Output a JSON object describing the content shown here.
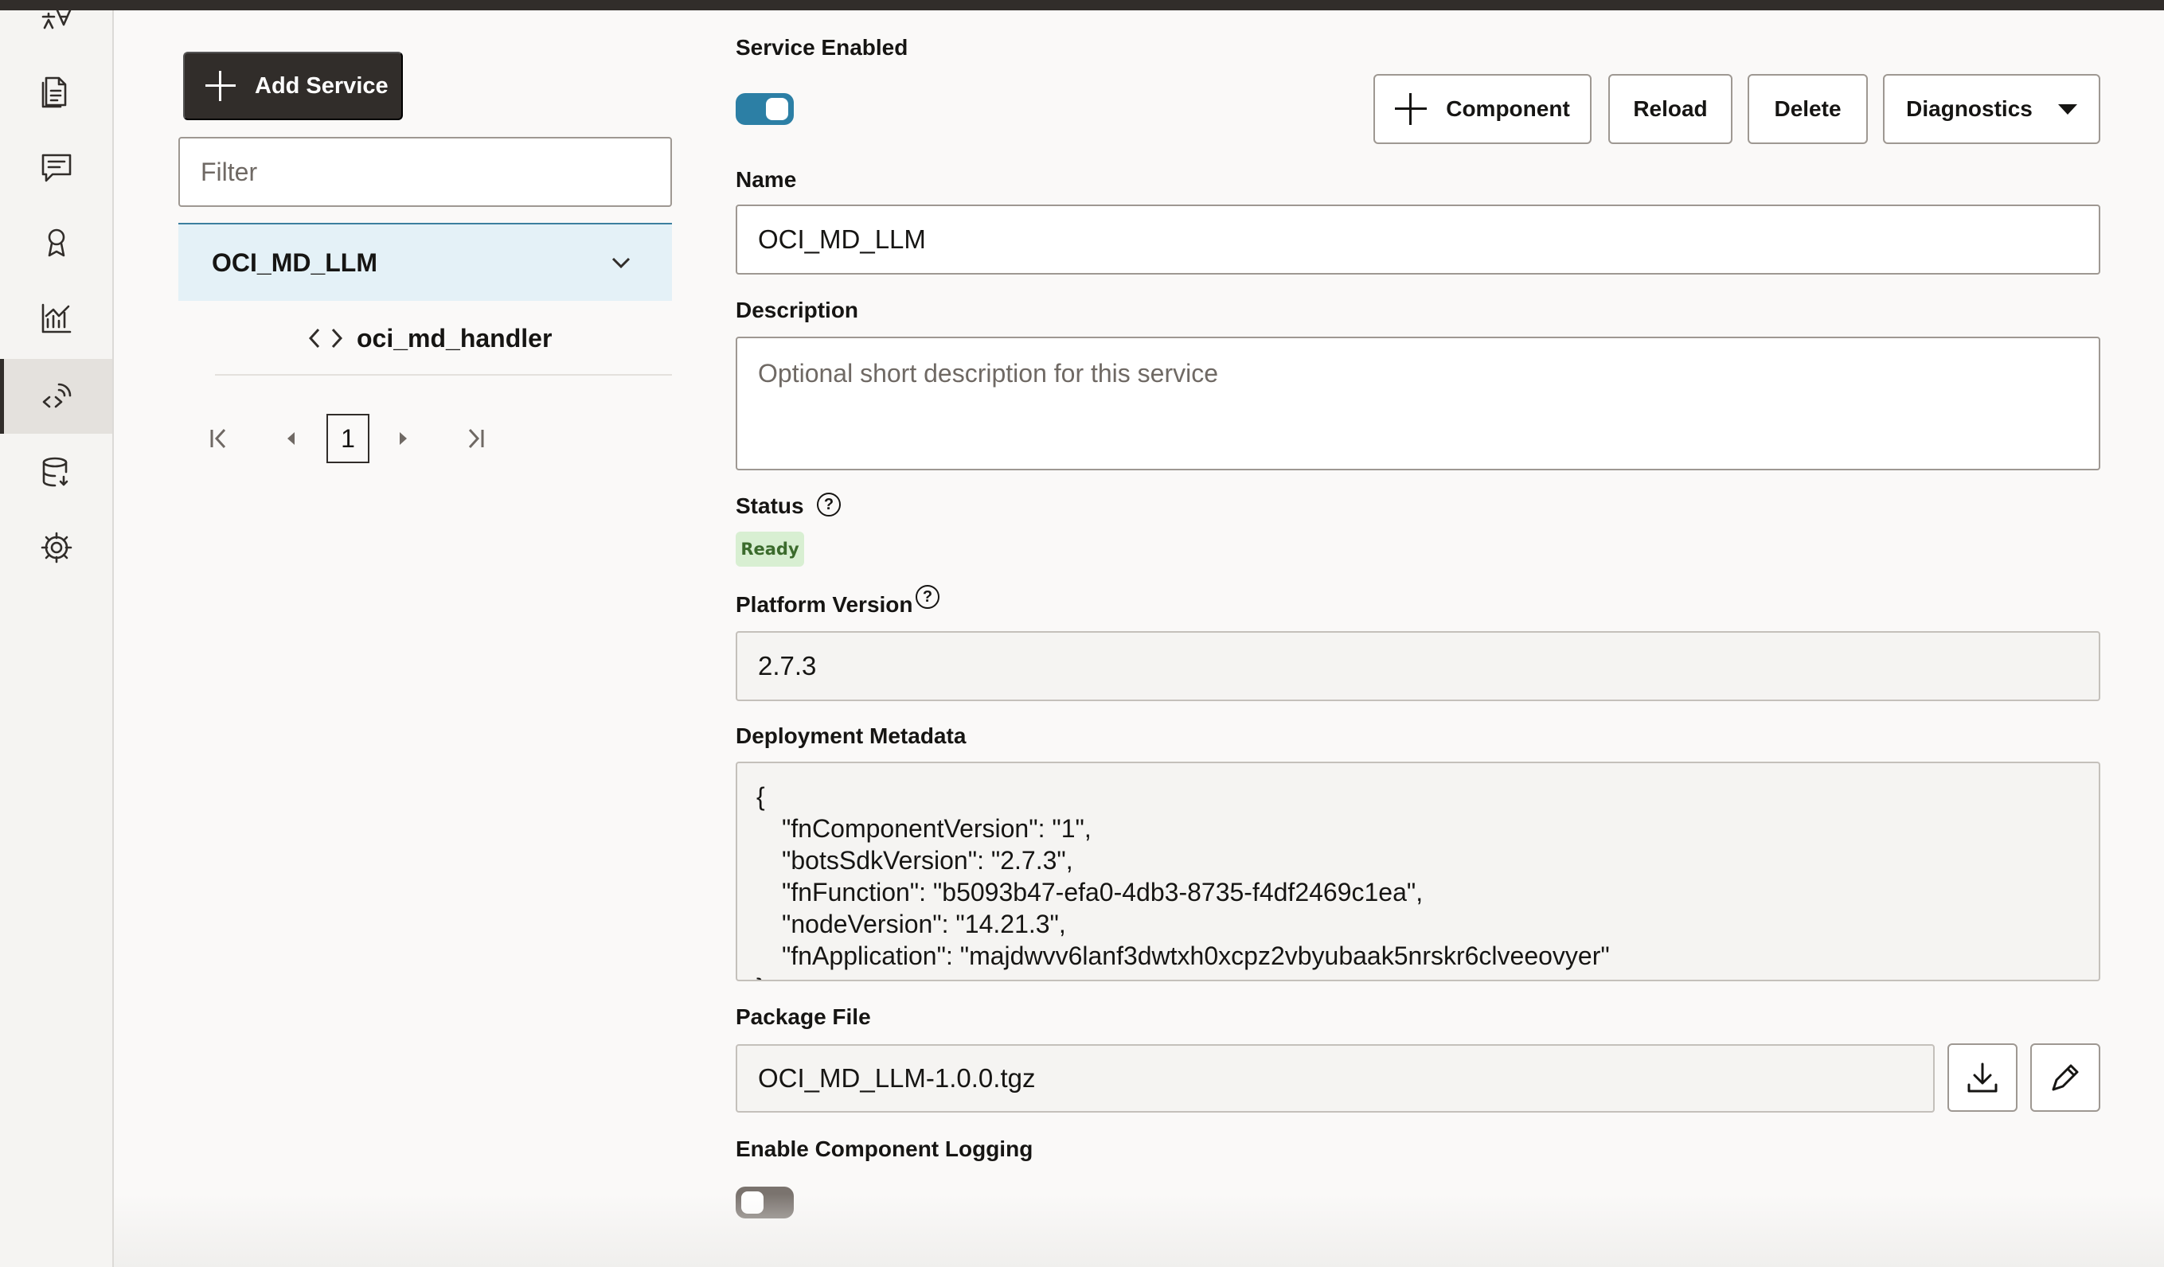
{
  "sidebar": {
    "add_service_label": "Add Service",
    "filter_placeholder": "Filter",
    "tree": {
      "service_name": "OCI_MD_LLM",
      "handler_name": "oci_md_handler"
    },
    "pagination": {
      "current_page": "1"
    },
    "nav_icons": [
      "translate-icon",
      "document-icon",
      "chat-icon",
      "badge-icon",
      "analytics-icon",
      "api-services-icon",
      "database-icon",
      "settings-icon"
    ]
  },
  "toolbar": {
    "component_label": "Component",
    "reload_label": "Reload",
    "delete_label": "Delete",
    "diagnostics_label": "Diagnostics"
  },
  "form": {
    "service_enabled_label": "Service Enabled",
    "service_enabled": true,
    "name_label": "Name",
    "name_value": "OCI_MD_LLM",
    "description_label": "Description",
    "description_placeholder": "Optional short description for this service",
    "status_label": "Status",
    "status_value": "Ready",
    "platform_version_label": "Platform Version",
    "platform_version_value": "2.7.3",
    "deployment_metadata_label": "Deployment Metadata",
    "deployment_metadata_lines": [
      "{",
      "\"fnComponentVersion\": \"1\",",
      "\"botsSdkVersion\": \"2.7.3\",",
      "\"fnFunction\": \"b5093b47-efa0-4db3-8735-f4df2469c1ea\",",
      "\"nodeVersion\": \"14.21.3\",",
      "\"fnApplication\": \"majdwvv6lanf3dwtxh0xcpz2vbyubaak5nrskr6clveeovyer\"",
      "}"
    ],
    "package_file_label": "Package File",
    "package_file_value": "OCI_MD_LLM-1.0.0.tgz",
    "enable_logging_label": "Enable Component Logging",
    "enable_logging": false
  },
  "colors": {
    "accent": "#2c7fa5",
    "dark": "#312d2a",
    "selected_row": "#e4f1f7",
    "status_ready_bg": "#d8efd2",
    "status_ready_text": "#3b6b2c"
  }
}
